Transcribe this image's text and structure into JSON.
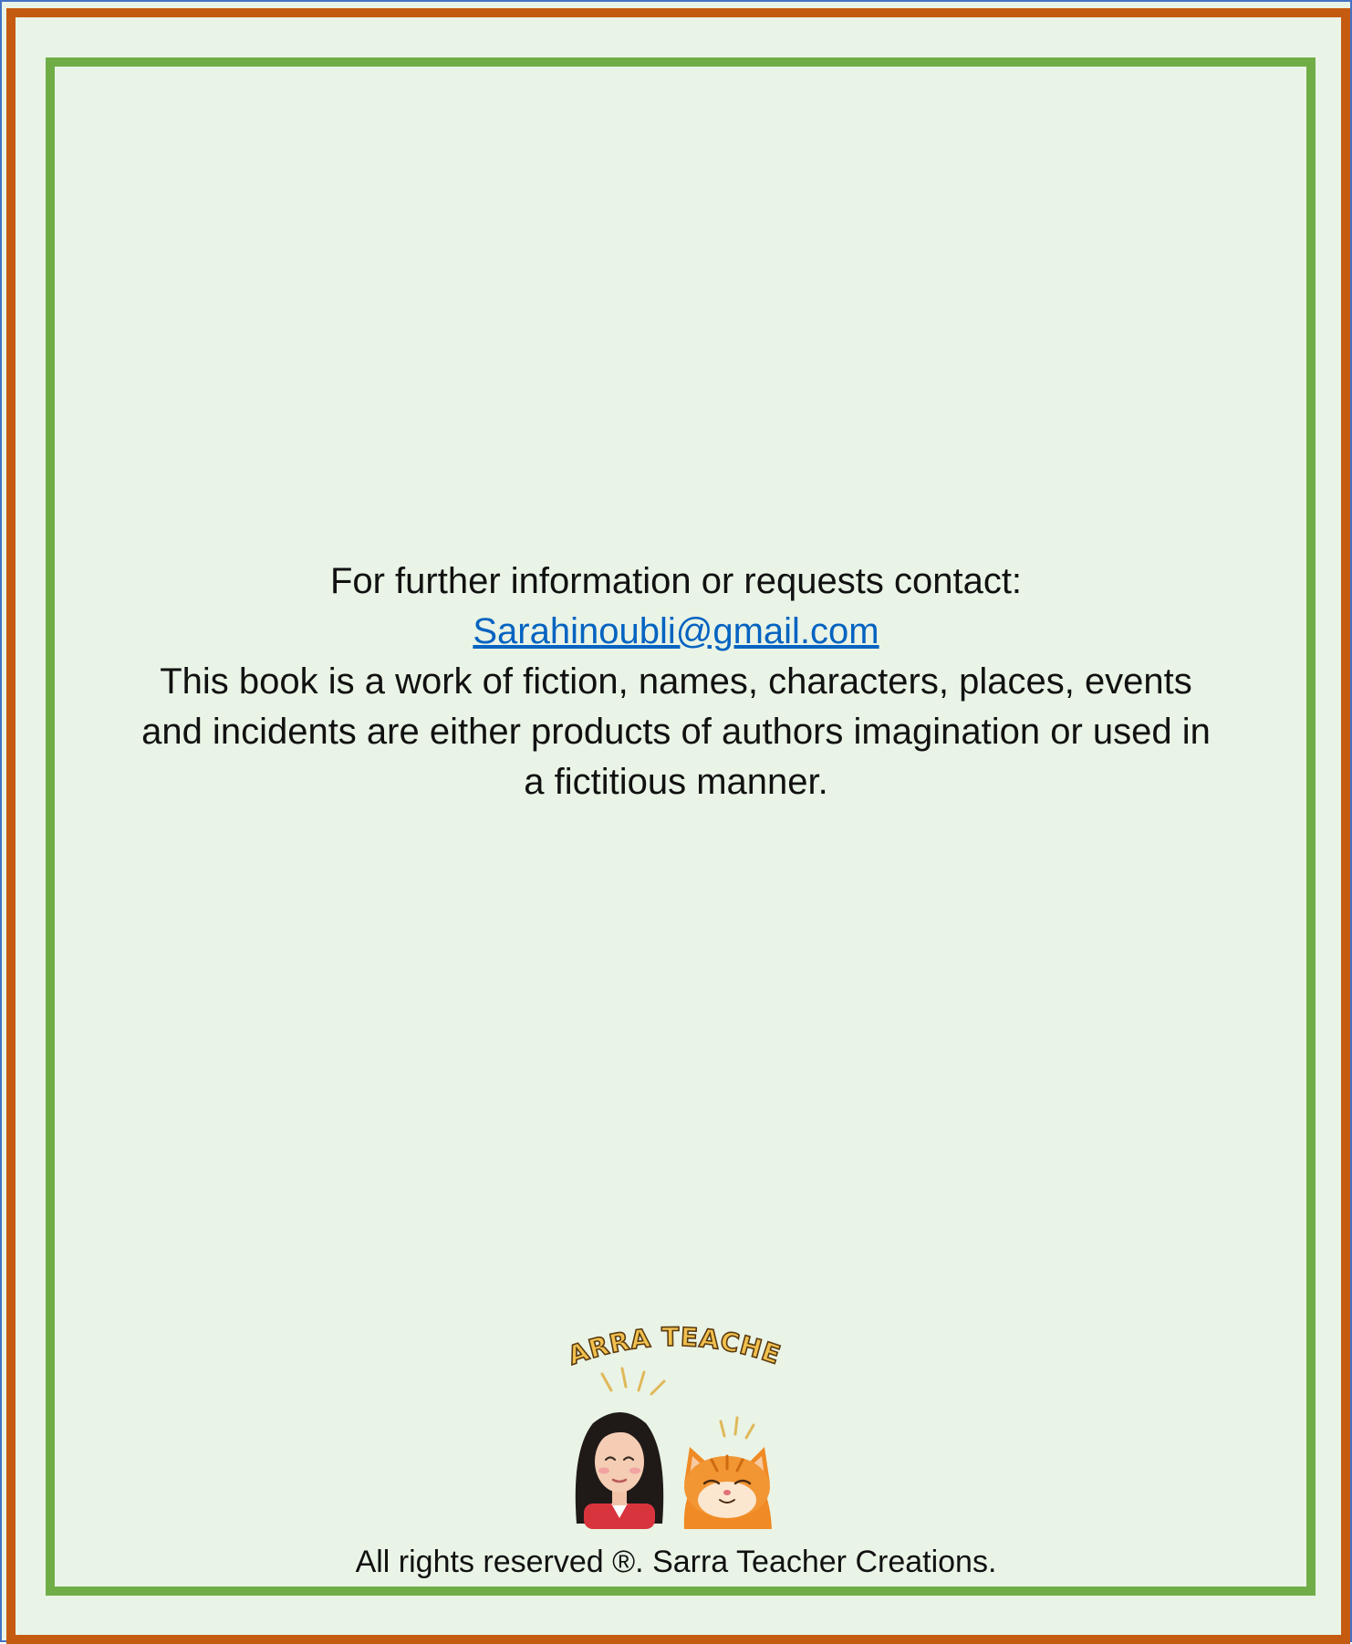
{
  "contact": {
    "heading": "For further information or requests contact:",
    "email": "Sarahinoubli@gmail.com"
  },
  "disclaimer": {
    "line1": "This book is a work of fiction, names, characters, places, events",
    "line2": "and incidents are either products of authors imagination or used in",
    "line3": "a fictitious manner."
  },
  "logo": {
    "text": "SARRA TEACHER",
    "icons": [
      "girl-avatar-icon",
      "cat-icon"
    ]
  },
  "footer": {
    "rights": "All rights reserved ®. Sarra Teacher Creations."
  },
  "colors": {
    "background": "#e9f4e6",
    "outer_frame": "#c55a11",
    "inner_frame": "#70ad47",
    "link": "#0563c1"
  }
}
